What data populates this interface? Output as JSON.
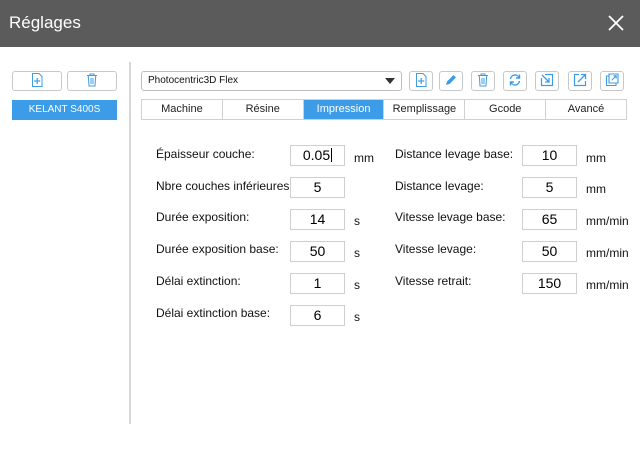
{
  "window": {
    "title": "Réglages"
  },
  "machines": {
    "items": [
      {
        "label": "KELANT S400S"
      }
    ]
  },
  "profile": {
    "selected": "Photocentric3D Flex"
  },
  "tabs": [
    {
      "label": "Machine"
    },
    {
      "label": "Résine"
    },
    {
      "label": "Impression"
    },
    {
      "label": "Remplissage"
    },
    {
      "label": "Gcode"
    },
    {
      "label": "Avancé"
    }
  ],
  "accent_color": "#3d9ce8",
  "settings": {
    "left": [
      {
        "label": "Épaisseur couche:",
        "value": "0.05",
        "unit": "mm"
      },
      {
        "label": "Nbre couches inférieures:",
        "value": "5",
        "unit": ""
      },
      {
        "label": "Durée exposition:",
        "value": "14",
        "unit": "s"
      },
      {
        "label": "Durée exposition base:",
        "value": "50",
        "unit": "s"
      },
      {
        "label": "Délai extinction:",
        "value": "1",
        "unit": "s"
      },
      {
        "label": "Délai extinction base:",
        "value": "6",
        "unit": "s"
      }
    ],
    "right": [
      {
        "label": "Distance levage base:",
        "value": "10",
        "unit": "mm"
      },
      {
        "label": "Distance levage:",
        "value": "5",
        "unit": "mm"
      },
      {
        "label": "Vitesse levage base:",
        "value": "65",
        "unit": "mm/min"
      },
      {
        "label": "Vitesse levage:",
        "value": "50",
        "unit": "mm/min"
      },
      {
        "label": "Vitesse retrait:",
        "value": "150",
        "unit": "mm/min"
      }
    ]
  }
}
